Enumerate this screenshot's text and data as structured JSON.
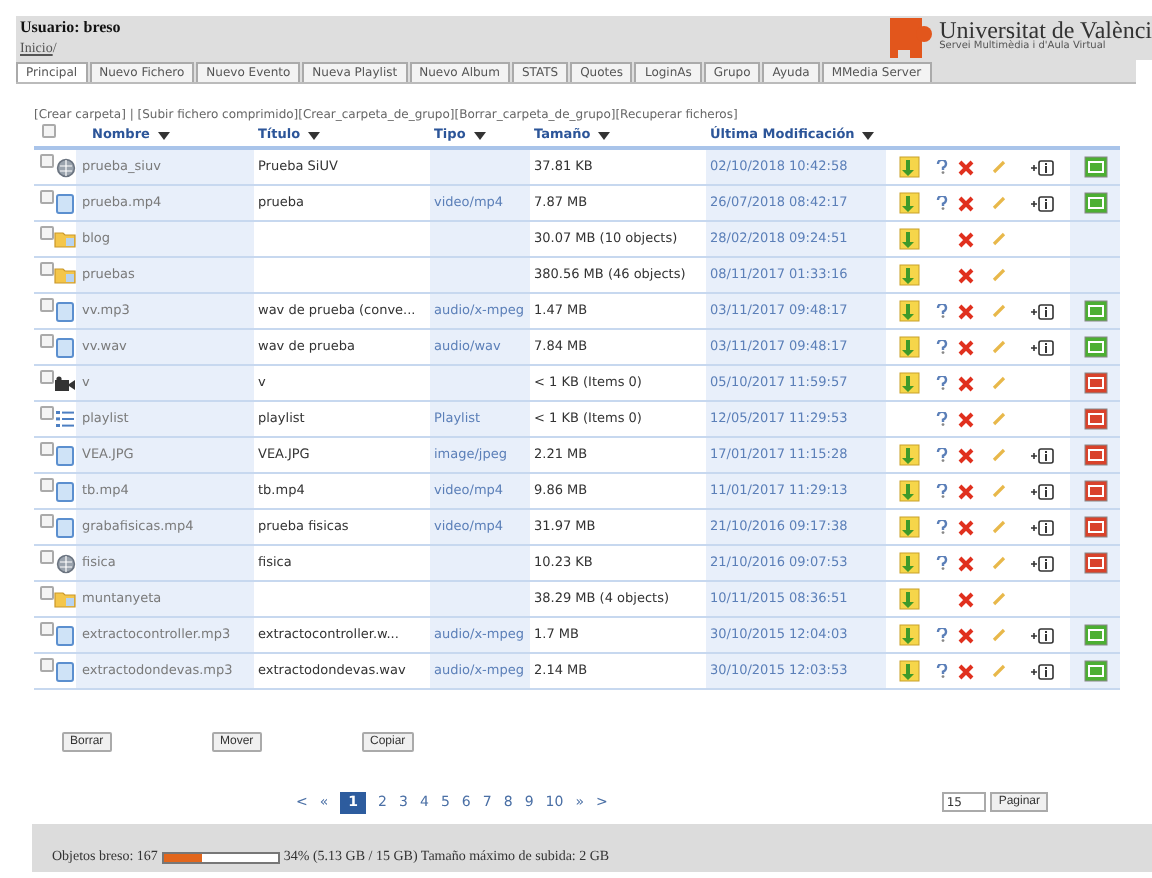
{
  "header": {
    "user": "Usuario: breso",
    "breadcrumb": "Inicio",
    "breadcrumb_sep": "/",
    "logo_text": "Universitat de Valènci",
    "logo_subtitle": "Servei Multimèdia i d'Aula Virtual"
  },
  "tabs": [
    {
      "label": "Principal",
      "selected": true
    },
    {
      "label": "Nuevo Fichero",
      "selected": false
    },
    {
      "label": "Nuevo Evento",
      "selected": false
    },
    {
      "label": "Nueva Playlist",
      "selected": false
    },
    {
      "label": "Nuevo Album",
      "selected": false
    },
    {
      "label": "STATS",
      "selected": false
    },
    {
      "label": "Quotes",
      "selected": false
    },
    {
      "label": "LoginAs",
      "selected": false
    },
    {
      "label": "Grupo",
      "selected": false
    },
    {
      "label": "Ayuda",
      "selected": false
    },
    {
      "label": "MMedia Server",
      "selected": false
    }
  ],
  "actions": [
    "[Crear carpeta]",
    " | ",
    "[Subir fichero comprimido]",
    "[Crear_carpeta_de_grupo]",
    "[Borrar_carpeta_de_grupo]",
    "[Recuperar ficheros]"
  ],
  "table": {
    "select_all_checked": false,
    "columns": [
      "Nombre",
      "Título",
      "Tipo",
      "Tamaño",
      "Última Modificación"
    ],
    "rows": [
      {
        "kind": "globe",
        "name": "prueba_siuv",
        "title": "Prueba SiUV",
        "type": "",
        "size": "37.81 KB",
        "date": "02/10/2018 10:42:58",
        "download": true,
        "info": true,
        "plus": true,
        "publish": true,
        "published": true,
        "checked": false
      },
      {
        "kind": "file",
        "name": "prueba.mp4",
        "title": "prueba",
        "type": "video/mp4",
        "size": "7.87 MB",
        "date": "26/07/2018 08:42:17",
        "download": true,
        "info": true,
        "plus": true,
        "publish": true,
        "published": true,
        "checked": false
      },
      {
        "kind": "folder",
        "name": "blog",
        "title": "",
        "type": "",
        "size": "30.07 MB (10 objects)",
        "date": "28/02/2018 09:24:51",
        "download": true,
        "info": false,
        "plus": false,
        "publish": false,
        "published": false,
        "checked": false
      },
      {
        "kind": "folder",
        "name": "pruebas",
        "title": "",
        "type": "",
        "size": "380.56 MB (46 objects)",
        "date": "08/11/2017 01:33:16",
        "download": true,
        "info": false,
        "plus": false,
        "publish": false,
        "published": false,
        "checked": false
      },
      {
        "kind": "file",
        "name": "vv.mp3",
        "title": "wav de prueba (conve...",
        "type": "audio/x-mpeg",
        "size": "1.47 MB",
        "date": "03/11/2017 09:48:17",
        "download": true,
        "info": true,
        "plus": true,
        "publish": true,
        "published": true,
        "checked": false
      },
      {
        "kind": "file",
        "name": "vv.wav",
        "title": "wav de prueba",
        "type": "audio/wav",
        "size": "7.84 MB",
        "date": "03/11/2017 09:48:17",
        "download": true,
        "info": true,
        "plus": true,
        "publish": true,
        "published": true,
        "checked": false
      },
      {
        "kind": "camera",
        "name": "v",
        "title": "v",
        "type": "",
        "size": "< 1 KB (Items 0)",
        "date": "05/10/2017 11:59:57",
        "download": true,
        "info": true,
        "plus": false,
        "publish": true,
        "published": false,
        "checked": false
      },
      {
        "kind": "list",
        "name": "playlist",
        "title": "playlist",
        "type": "Playlist",
        "size": "< 1 KB (Items 0)",
        "date": "12/05/2017 11:29:53",
        "download": false,
        "info": true,
        "plus": false,
        "publish": true,
        "published": false,
        "checked": false
      },
      {
        "kind": "file",
        "name": "VEA.JPG",
        "title": "VEA.JPG",
        "type": "image/jpeg",
        "size": "2.21 MB",
        "date": "17/01/2017 11:15:28",
        "download": true,
        "info": true,
        "plus": true,
        "publish": true,
        "published": false,
        "checked": false
      },
      {
        "kind": "file",
        "name": "tb.mp4",
        "title": "tb.mp4",
        "type": "video/mp4",
        "size": "9.86 MB",
        "date": "11/01/2017 11:29:13",
        "download": true,
        "info": true,
        "plus": true,
        "publish": true,
        "published": false,
        "checked": false
      },
      {
        "kind": "file",
        "name": "grabafisicas.mp4",
        "title": "prueba fisicas",
        "type": "video/mp4",
        "size": "31.97 MB",
        "date": "21/10/2016 09:17:38",
        "download": true,
        "info": true,
        "plus": true,
        "publish": true,
        "published": false,
        "checked": false
      },
      {
        "kind": "globe",
        "name": "fisica",
        "title": "fisica",
        "type": "",
        "size": "10.23 KB",
        "date": "21/10/2016 09:07:53",
        "download": true,
        "info": true,
        "plus": true,
        "publish": true,
        "published": false,
        "checked": false
      },
      {
        "kind": "folder",
        "name": "muntanyeta",
        "title": "",
        "type": "",
        "size": "38.29 MB (4 objects)",
        "date": "10/11/2015 08:36:51",
        "download": true,
        "info": false,
        "plus": false,
        "publish": false,
        "published": false,
        "checked": false
      },
      {
        "kind": "file",
        "name": "extractocontroller.mp3",
        "title": "extractocontroller.w...",
        "type": "audio/x-mpeg",
        "size": "1.7 MB",
        "date": "30/10/2015 12:04:03",
        "download": true,
        "info": true,
        "plus": true,
        "publish": true,
        "published": true,
        "checked": false
      },
      {
        "kind": "file",
        "name": "extractodondevas.mp3",
        "title": "extractodondevas.wav",
        "type": "audio/x-mpeg",
        "size": "2.14 MB",
        "date": "30/10/2015 12:03:53",
        "download": true,
        "info": true,
        "plus": true,
        "publish": true,
        "published": true,
        "checked": false
      }
    ]
  },
  "buttons": [
    "Borrar",
    "Mover",
    "Copiar"
  ],
  "pagination": {
    "prev": [
      "<",
      "«"
    ],
    "pages": [
      {
        "label": "1",
        "selected": true
      },
      {
        "label": "2",
        "selected": false
      },
      {
        "label": "3",
        "selected": false
      },
      {
        "label": "4",
        "selected": false
      },
      {
        "label": "5",
        "selected": false
      },
      {
        "label": "6",
        "selected": false
      },
      {
        "label": "7",
        "selected": false
      },
      {
        "label": "8",
        "selected": false
      },
      {
        "label": "9",
        "selected": false
      },
      {
        "label": "10",
        "selected": false
      }
    ],
    "next": [
      "»",
      ">"
    ],
    "per_page": "15",
    "button": "Paginar"
  },
  "footer": {
    "objects": "Objetos breso: 167",
    "level": 0.34,
    "usage": "34% (5.13 GB / 15 GB) Tamaño máximo de subida: 2 GB"
  }
}
